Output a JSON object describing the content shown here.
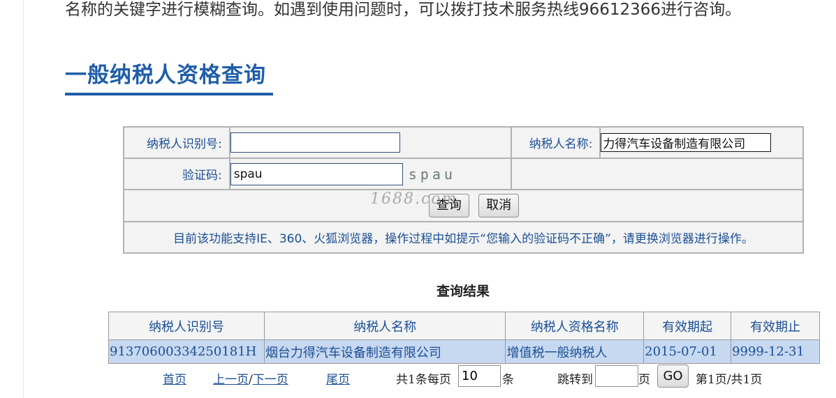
{
  "intro_text": "名称的关键字进行模糊查询。如遇到使用问题时，可以拨打技术服务热线96612366进行咨询。",
  "heading": "一般纳税人资格查询",
  "form": {
    "taxpayer_id_label": "纳税人识别号:",
    "taxpayer_id_value": "",
    "taxpayer_name_label": "纳税人名称:",
    "taxpayer_name_value": "力得汽车设备制造有限公司",
    "captcha_label": "验证码:",
    "captcha_value": "spau",
    "captcha_image_text": "spau",
    "query_button": "查询",
    "cancel_button": "取消",
    "notice": "目前该功能支持IE、360、火狐浏览器，操作过程中如提示“您输入的验证码不正确”，请更换浏览器进行操作。"
  },
  "watermark": "1688.com",
  "results": {
    "title": "查询结果",
    "columns": [
      "纳税人识别号",
      "纳税人名称",
      "纳税人资格名称",
      "有效期起",
      "有效期止"
    ],
    "rows": [
      [
        "91370600334250181H",
        "烟台力得汽车设备制造有限公司",
        "增值税一般纳税人",
        "2015-07-01",
        "9999-12-31"
      ]
    ]
  },
  "pager": {
    "first": "首页",
    "prev": "上一页",
    "separator": "/",
    "next": "下一页",
    "last": "尾页",
    "total_prefix": "共1条每页",
    "page_size": "10",
    "unit": "条",
    "jump_label": "跳转到",
    "jump_value": "",
    "page_unit": "页",
    "go_button": "GO",
    "page_info": "第1页/共1页"
  },
  "colors": {
    "heading_blue": "#1f5ea8",
    "link_blue": "#1a4f94",
    "row_highlight": "#c7d8f1",
    "border_gray": "#b2b2b2"
  }
}
